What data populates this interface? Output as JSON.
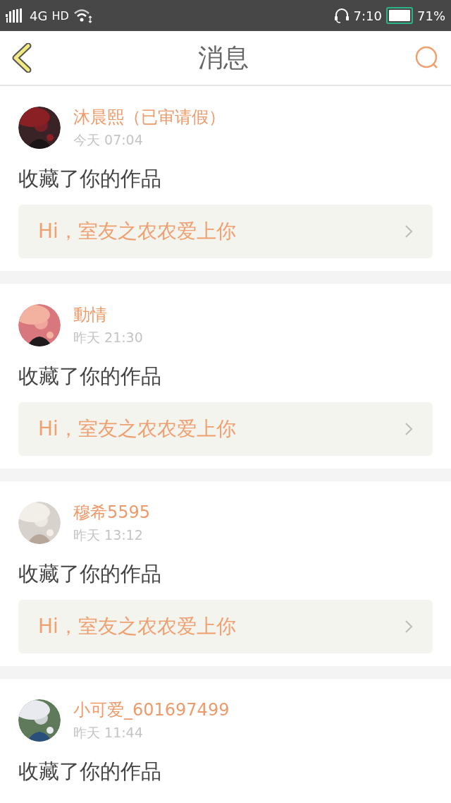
{
  "status_bar": {
    "network": "4G",
    "hd": "HD",
    "time": "7:10",
    "battery_text": "71%"
  },
  "header": {
    "title": "消息"
  },
  "messages": [
    {
      "name": "沐晨熙（已审请假）",
      "time": "今天 07:04",
      "action": "收藏了你的作品",
      "link": "Hi，室友之农农爱上你"
    },
    {
      "name": "動情",
      "time": "昨天 21:30",
      "action": "收藏了你的作品",
      "link": "Hi，室友之农农爱上你"
    },
    {
      "name": "穆希5595",
      "time": "昨天 13:12",
      "action": "收藏了你的作品",
      "link": "Hi，室友之农农爱上你"
    },
    {
      "name": "小可爱_601697499",
      "time": "昨天 11:44",
      "action": "收藏了你的作品"
    }
  ]
}
